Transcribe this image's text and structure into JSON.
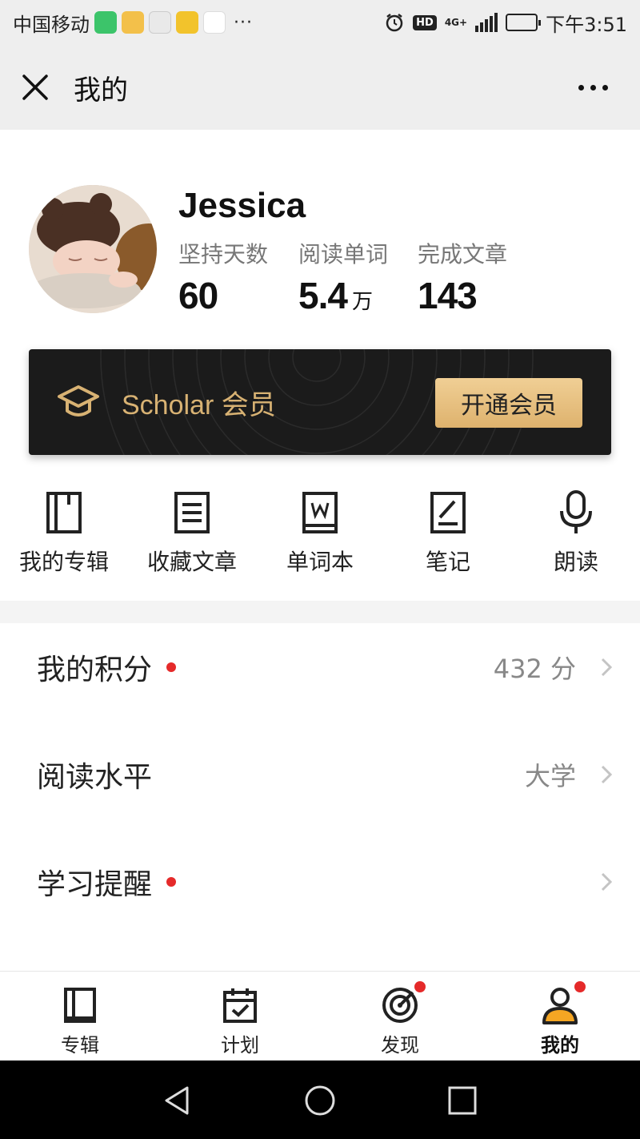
{
  "status_bar": {
    "carrier": "中国移动",
    "app_icon_colors": [
      "#3cc46a",
      "#f3c04a",
      "#e9e9e9",
      "#f2c32c",
      "#4a7cf6"
    ],
    "hd": "HD",
    "network": "4G+",
    "time": "下午3:51",
    "battery_level": 0.55
  },
  "nav": {
    "title": "我的",
    "close_icon": "close-icon",
    "more_icon": "more-icon"
  },
  "profile": {
    "name": "Jessica",
    "stats": [
      {
        "label": "坚持天数",
        "value": "60",
        "unit": ""
      },
      {
        "label": "阅读单词",
        "value": "5.4",
        "unit": "万"
      },
      {
        "label": "完成文章",
        "value": "143",
        "unit": ""
      }
    ]
  },
  "membership": {
    "label": "Scholar 会员",
    "button": "开通会员",
    "accent": "#d8b273"
  },
  "quick_actions": [
    {
      "label": "我的专辑",
      "icon": "album-icon"
    },
    {
      "label": "收藏文章",
      "icon": "article-icon"
    },
    {
      "label": "单词本",
      "icon": "wordbook-icon"
    },
    {
      "label": "笔记",
      "icon": "note-icon"
    },
    {
      "label": "朗读",
      "icon": "microphone-icon"
    }
  ],
  "list": [
    {
      "label": "我的积分",
      "value": "432 分",
      "badge": true
    },
    {
      "label": "阅读水平",
      "value": "大学",
      "badge": false
    },
    {
      "label": "学习提醒",
      "value": "",
      "badge": true
    }
  ],
  "tabs": [
    {
      "label": "专辑",
      "icon": "album-tab-icon",
      "active": false,
      "badge": false
    },
    {
      "label": "计划",
      "icon": "calendar-icon",
      "active": false,
      "badge": false
    },
    {
      "label": "发现",
      "icon": "target-icon",
      "active": false,
      "badge": true
    },
    {
      "label": "我的",
      "icon": "user-icon",
      "active": true,
      "badge": true
    }
  ],
  "colors": {
    "badge": "#e52a2a",
    "active_tab_icon": "#f5a623"
  }
}
